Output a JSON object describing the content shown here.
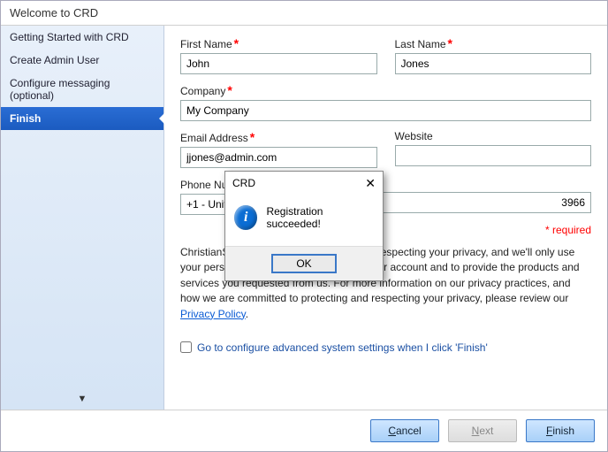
{
  "title": "Welcome to CRD",
  "sidebar": {
    "items": [
      {
        "label": "Getting Started with CRD"
      },
      {
        "label": "Create Admin User"
      },
      {
        "label": "Configure messaging (optional)"
      },
      {
        "label": "Finish"
      }
    ]
  },
  "form": {
    "firstName": {
      "label": "First Name",
      "value": "John"
    },
    "lastName": {
      "label": "Last Name",
      "value": "Jones"
    },
    "company": {
      "label": "Company",
      "value": "My Company"
    },
    "email": {
      "label": "Email Address",
      "value": "jjones@admin.com"
    },
    "website": {
      "label": "Website",
      "value": ""
    },
    "phoneCode": {
      "label": "Phone Num",
      "value": "+1 - United"
    },
    "phone": {
      "value": "3966"
    },
    "requiredNote": "* required",
    "privacyText": "ChristianSteven Software is committed to respecting your privacy, and we'll only use your personal information to administer your account and to provide the products and services you requested from us. For more information on our privacy practices, and how we are committed to protecting and respecting your privacy, please review our ",
    "privacyLink": "Privacy Policy",
    "advanced": "Go to configure advanced system settings when I click 'Finish'"
  },
  "footer": {
    "cancel": "Cancel",
    "next": "Next",
    "finish": "Finish"
  },
  "dialog": {
    "title": "CRD",
    "message": "Registration succeeded!",
    "ok": "OK"
  }
}
